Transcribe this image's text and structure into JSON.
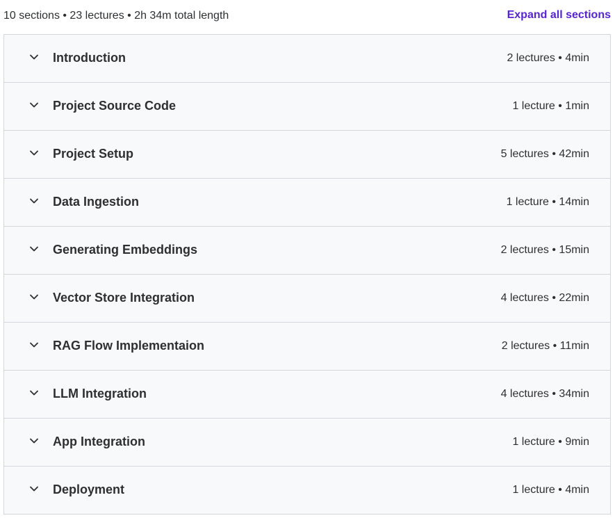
{
  "summary": {
    "text": "10 sections • 23 lectures • 2h 34m total length",
    "expand_all_label": "Expand all sections"
  },
  "colors": {
    "accent": "#5624d0",
    "section_background": "#f7f9fa",
    "border": "#d1d7dc",
    "text": "#2d2f31"
  },
  "sections": [
    {
      "title": "Introduction",
      "meta": "2 lectures • 4min",
      "icon": "chevron-down-icon"
    },
    {
      "title": "Project Source Code",
      "meta": "1 lecture • 1min",
      "icon": "chevron-down-icon"
    },
    {
      "title": "Project Setup",
      "meta": "5 lectures • 42min",
      "icon": "chevron-down-icon"
    },
    {
      "title": "Data Ingestion",
      "meta": "1 lecture • 14min",
      "icon": "chevron-down-icon"
    },
    {
      "title": "Generating Embeddings",
      "meta": "2 lectures • 15min",
      "icon": "chevron-down-icon"
    },
    {
      "title": "Vector Store Integration",
      "meta": "4 lectures • 22min",
      "icon": "chevron-down-icon"
    },
    {
      "title": "RAG Flow Implementaion",
      "meta": "2 lectures • 11min",
      "icon": "chevron-down-icon"
    },
    {
      "title": "LLM Integration",
      "meta": "4 lectures • 34min",
      "icon": "chevron-down-icon"
    },
    {
      "title": "App Integration",
      "meta": "1 lecture • 9min",
      "icon": "chevron-down-icon"
    },
    {
      "title": "Deployment",
      "meta": "1 lecture • 4min",
      "icon": "chevron-down-icon"
    }
  ]
}
